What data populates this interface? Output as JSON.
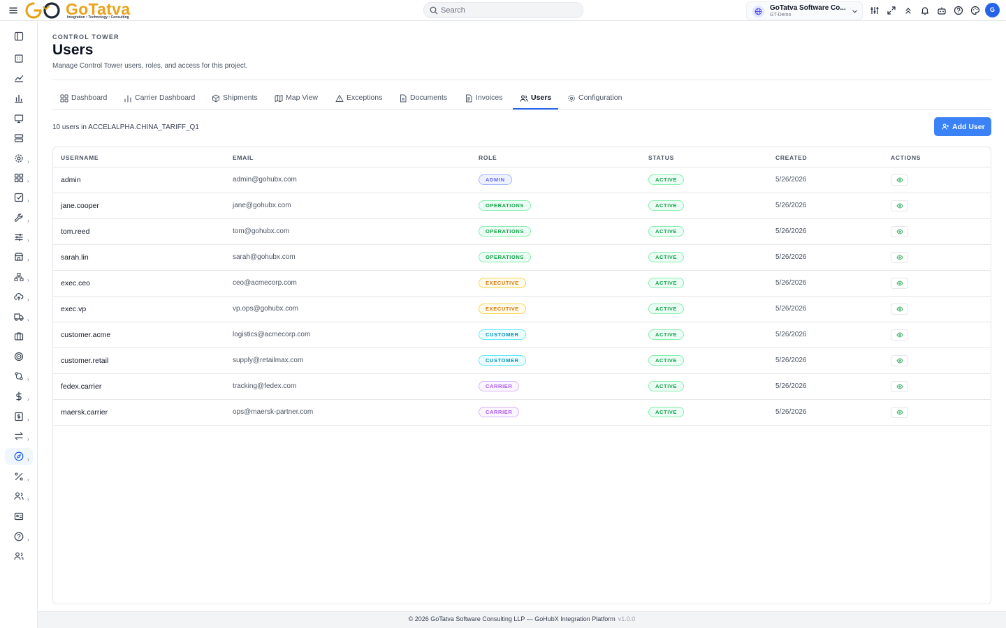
{
  "header": {
    "brand": "GoTatva",
    "tagline": "Integration • Technology • Consulting",
    "search_placeholder": "Search",
    "tenant_name": "GoTatva Software Co...",
    "tenant_sub": "GT-Demo",
    "avatar_initial": "G"
  },
  "page": {
    "eyebrow": "CONTROL TOWER",
    "title": "Users",
    "subtitle": "Manage Control Tower users, roles, and access for this project."
  },
  "tabs": [
    {
      "label": "Dashboard",
      "icon": "grid-icon"
    },
    {
      "label": "Carrier Dashboard",
      "icon": "bar-chart-icon"
    },
    {
      "label": "Shipments",
      "icon": "package-icon"
    },
    {
      "label": "Map View",
      "icon": "map-icon"
    },
    {
      "label": "Exceptions",
      "icon": "warning-icon"
    },
    {
      "label": "Documents",
      "icon": "document-icon"
    },
    {
      "label": "Invoices",
      "icon": "invoice-icon"
    },
    {
      "label": "Users",
      "icon": "users-icon",
      "active": true
    },
    {
      "label": "Configuration",
      "icon": "gear-icon"
    }
  ],
  "summary": {
    "count_text": "10 users in ACCELALPHA.CHINA_TARIFF_Q1",
    "add_label": "Add User"
  },
  "table": {
    "columns": [
      "USERNAME",
      "EMAIL",
      "ROLE",
      "STATUS",
      "CREATED",
      "ACTIONS"
    ],
    "rows": [
      {
        "username": "admin",
        "email": "admin@gohubx.com",
        "role": "ADMIN",
        "status": "ACTIVE",
        "created": "5/26/2026"
      },
      {
        "username": "jane.cooper",
        "email": "jane@gohubx.com",
        "role": "OPERATIONS",
        "status": "ACTIVE",
        "created": "5/26/2026"
      },
      {
        "username": "tom.reed",
        "email": "tom@gohubx.com",
        "role": "OPERATIONS",
        "status": "ACTIVE",
        "created": "5/26/2026"
      },
      {
        "username": "sarah.lin",
        "email": "sarah@gohubx.com",
        "role": "OPERATIONS",
        "status": "ACTIVE",
        "created": "5/26/2026"
      },
      {
        "username": "exec.ceo",
        "email": "ceo@acmecorp.com",
        "role": "EXECUTIVE",
        "status": "ACTIVE",
        "created": "5/26/2026"
      },
      {
        "username": "exec.vp",
        "email": "vp.ops@gohubx.com",
        "role": "EXECUTIVE",
        "status": "ACTIVE",
        "created": "5/26/2026"
      },
      {
        "username": "customer.acme",
        "email": "logistics@acmecorp.com",
        "role": "CUSTOMER",
        "status": "ACTIVE",
        "created": "5/26/2026"
      },
      {
        "username": "customer.retail",
        "email": "supply@retailmax.com",
        "role": "CUSTOMER",
        "status": "ACTIVE",
        "created": "5/26/2026"
      },
      {
        "username": "fedex.carrier",
        "email": "tracking@fedex.com",
        "role": "CARRIER",
        "status": "ACTIVE",
        "created": "5/26/2026"
      },
      {
        "username": "maersk.carrier",
        "email": "ops@maersk-partner.com",
        "role": "CARRIER",
        "status": "ACTIVE",
        "created": "5/26/2026"
      }
    ]
  },
  "footer": {
    "text": "© 2026 GoTatva Software Consulting LLP — GoHubX Integration Platform",
    "version": "v1.0.0"
  },
  "colors": {
    "accent": "#3b82f6",
    "brand_orange": "#e8a31c",
    "active_green": "#16a34a"
  }
}
